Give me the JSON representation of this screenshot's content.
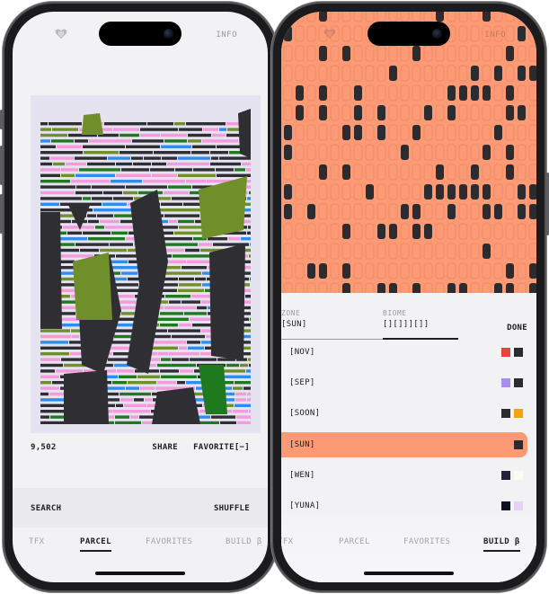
{
  "left_phone": {
    "header": {
      "logo_icon": "heart-shield-icon",
      "info_label": "INFO"
    },
    "artwork": {
      "description_colors": {
        "background": "#e4e3ef",
        "dark": "#2e2e33",
        "pink": "#f39bdc",
        "blue": "#2b8ef0",
        "green": "#1f7a1f",
        "olive": "#6f8f2a"
      }
    },
    "stats": {
      "count": "9,502",
      "share_label": "SHARE",
      "favorite_label": "FAVORITE[−]"
    },
    "actions": {
      "search_label": "SEARCH",
      "shuffle_label": "SHUFFLE"
    },
    "tabs": [
      {
        "label": "TFX",
        "active": false
      },
      {
        "label": "PARCEL",
        "active": true
      },
      {
        "label": "FAVORITES",
        "active": false
      },
      {
        "label": "BUILD β",
        "active": false
      }
    ]
  },
  "right_phone": {
    "header": {
      "logo_icon": "heart-shield-icon",
      "info_label": "INFO"
    },
    "grid": {
      "background_color": "#fb9a74",
      "filled_color": "#2c2c30",
      "outline_color": "#f08a66"
    },
    "sheet": {
      "tabs": [
        {
          "label": "ZONE",
          "value": "[SUN]"
        },
        {
          "label": "BIOME",
          "value": "[][]]][]]"
        }
      ],
      "done_label": "DONE",
      "biomes": [
        {
          "name": "[NOV]",
          "selected": false,
          "swatches": [
            "#e8423a",
            "#2c2c30"
          ]
        },
        {
          "name": "[SEP]",
          "selected": false,
          "swatches": [
            "#a78df5",
            "#2c2c30"
          ]
        },
        {
          "name": "[SOON]",
          "selected": false,
          "swatches": [
            "#2c2c30",
            "#f5a20f"
          ]
        },
        {
          "name": "[SUN]",
          "selected": true,
          "swatches": [
            "#2c2c30"
          ]
        },
        {
          "name": "[WEN]",
          "selected": false,
          "swatches": [
            "#23233a",
            "#fbfbf3"
          ]
        },
        {
          "name": "[YUNA]",
          "selected": false,
          "swatches": [
            "#0d1024",
            "#ead0f7"
          ]
        }
      ]
    },
    "tabs": [
      {
        "label": "TFX",
        "active": false
      },
      {
        "label": "PARCEL",
        "active": false
      },
      {
        "label": "FAVORITES",
        "active": false
      },
      {
        "label": "BUILD β",
        "active": true
      }
    ]
  }
}
